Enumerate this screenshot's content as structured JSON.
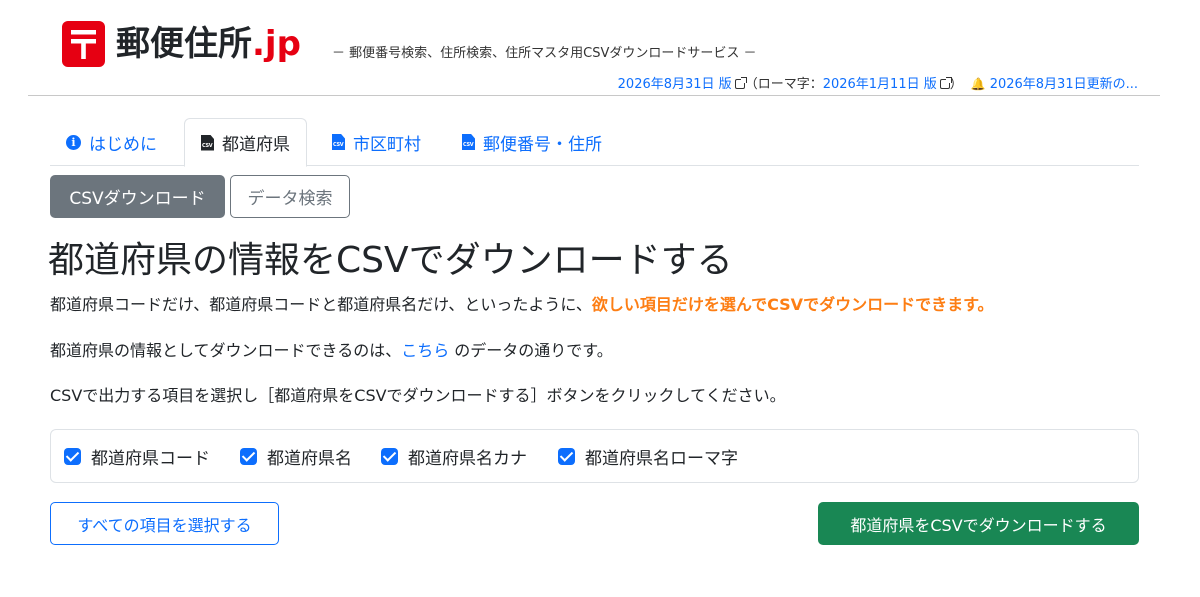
{
  "header": {
    "title_main": "郵便住所",
    "title_tld": ".jp",
    "tagline": "－ 郵便番号検索、住所検索、住所マスタ用CSVダウンロードサービス －",
    "version_link": "2026年8月31日 版",
    "romaji_prefix": "（ローマ字：",
    "romaji_link": "2026年1月11日 版",
    "romaji_suffix": "）",
    "update_link": "2026年8月31日更新の..."
  },
  "tabs": [
    {
      "label": "はじめに",
      "icon": "info-icon"
    },
    {
      "label": "都道府県",
      "icon": "csv-file-icon",
      "active": true
    },
    {
      "label": "市区町村",
      "icon": "csv-file-icon"
    },
    {
      "label": "郵便番号・住所",
      "icon": "csv-file-icon"
    }
  ],
  "subnav": {
    "csv_download": "CSVダウンロード",
    "data_search": "データ検索"
  },
  "main": {
    "title": "都道府県の情報をCSVでダウンロードする",
    "para1_prefix": "都道府県コードだけ、都道府県コードと都道府県名だけ、といったように、",
    "para1_highlight": "欲しい項目だけを選んでCSVでダウンロードできます。",
    "para2_prefix": "都道府県の情報としてダウンロードできるのは、",
    "para2_link": "こちら",
    "para2_suffix": " のデータの通りです。",
    "para3": "CSVで出力する項目を選択し［都道府県をCSVでダウンロードする］ボタンをクリックしてください。"
  },
  "checkboxes": [
    {
      "label": "都道府県コード",
      "checked": true
    },
    {
      "label": "都道府県名",
      "checked": true
    },
    {
      "label": "都道府県名カナ",
      "checked": true
    },
    {
      "label": "都道府県名ローマ字",
      "checked": true
    }
  ],
  "buttons": {
    "select_all": "すべての項目を選択する",
    "download": "都道府県をCSVでダウンロードする"
  },
  "colors": {
    "brand_red": "#e60012",
    "link_blue": "#0d6efd",
    "highlight_orange": "#fd7e14",
    "success_green": "#198754",
    "secondary_gray": "#6c757d"
  }
}
